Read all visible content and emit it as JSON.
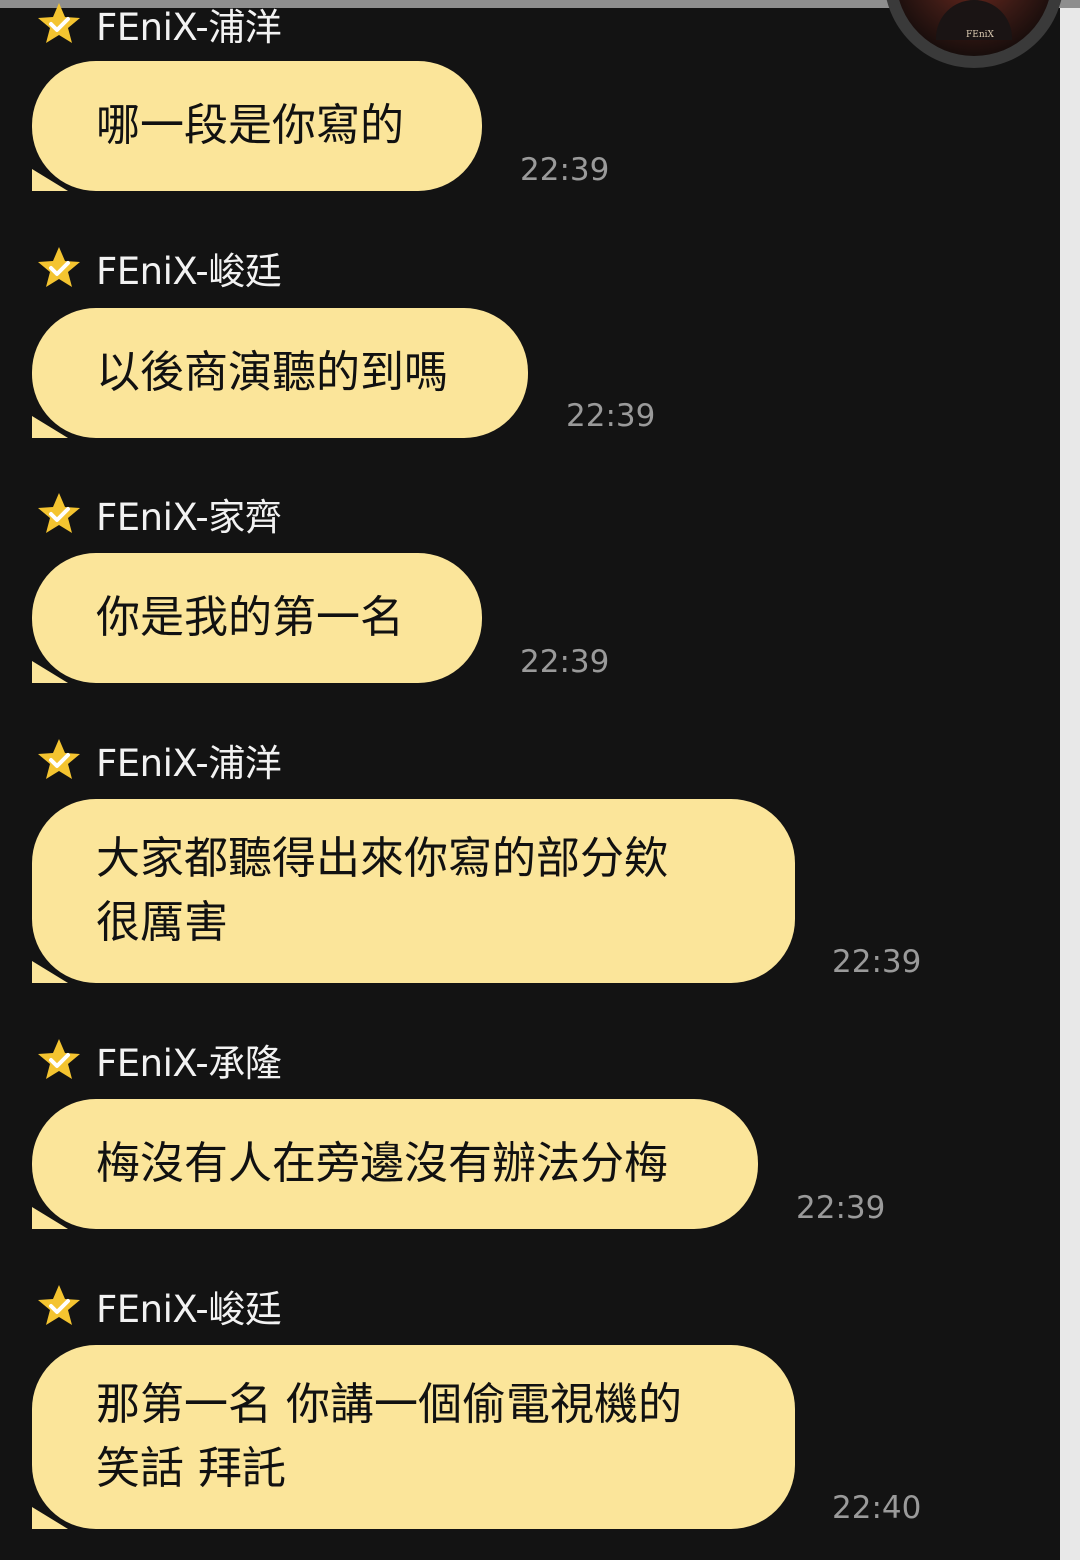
{
  "colors": {
    "background": "#131313",
    "bubble": "#fbe59a",
    "sender_text": "#f2f2f2",
    "time_text": "#9a9a9a",
    "star": "#f4c430"
  },
  "messages": [
    {
      "sender": "FEniX-浦洋",
      "text": "哪一段是你寫的",
      "time": "22:39",
      "icon": "verified-star-icon"
    },
    {
      "sender": "FEniX-峻廷",
      "text": "以後商演聽的到嗎",
      "time": "22:39",
      "icon": "verified-star-icon"
    },
    {
      "sender": "FEniX-家齊",
      "text": "你是我的第一名",
      "time": "22:39",
      "icon": "verified-star-icon"
    },
    {
      "sender": "FEniX-浦洋",
      "text": "大家都聽得出來你寫的部分欸\n很厲害",
      "time": "22:39",
      "icon": "verified-star-icon"
    },
    {
      "sender": "FEniX-承隆",
      "text": "梅沒有人在旁邊沒有辦法分梅",
      "time": "22:39",
      "icon": "verified-star-icon"
    },
    {
      "sender": "FEniX-峻廷",
      "text": "那第一名 你講一個偷電視機的\n笑話 拜託",
      "time": "22:40",
      "icon": "verified-star-icon"
    }
  ],
  "avatar": {
    "caption": "FEniX"
  }
}
